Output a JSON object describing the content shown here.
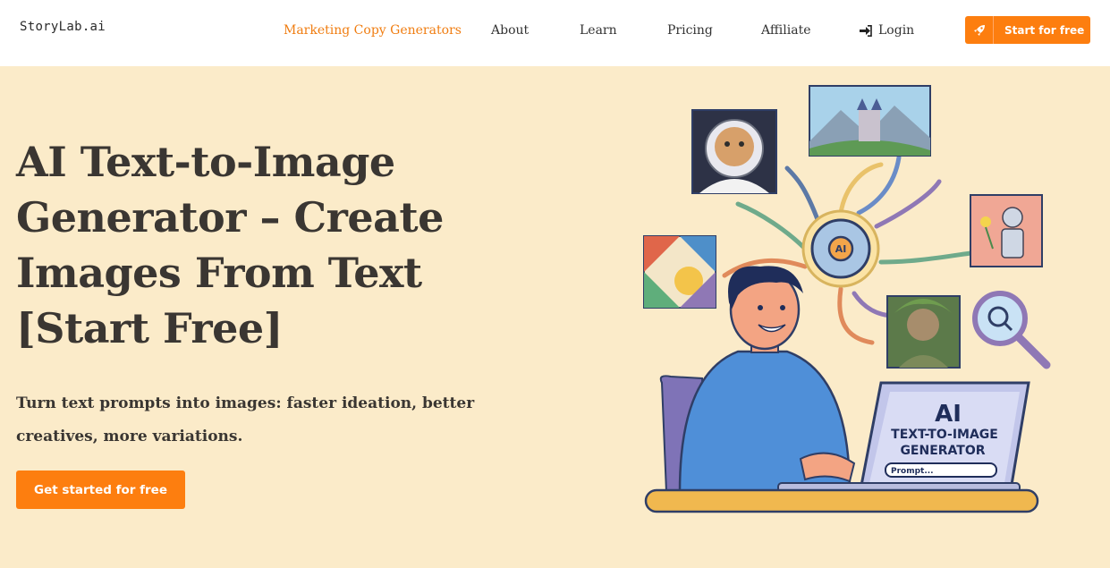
{
  "header": {
    "logo": "StoryLab.ai",
    "nav": [
      {
        "label": "Marketing Copy Generators",
        "active": true
      },
      {
        "label": "About"
      },
      {
        "label": "Learn"
      },
      {
        "label": "Pricing"
      },
      {
        "label": "Affiliate"
      }
    ],
    "login_label": "Login",
    "cta_label": "Start for free"
  },
  "hero": {
    "title": "AI Text-to-Image Generator – Create Images From Text [Start Free]",
    "subtitle": "Turn text prompts into images: faster ideation, better creatives, more variations.",
    "cta_label": "Get started for free"
  },
  "illustration": {
    "brain_label": "AI",
    "screen_title": "AI",
    "screen_line1": "TEXT-TO-IMAGE",
    "screen_line2": "GENERATOR",
    "prompt_text": "Prompt..."
  },
  "colors": {
    "accent": "#fd7e0f",
    "active_nav": "#f07d11",
    "hero_bg": "#fbebc9",
    "text": "#3a3632"
  }
}
